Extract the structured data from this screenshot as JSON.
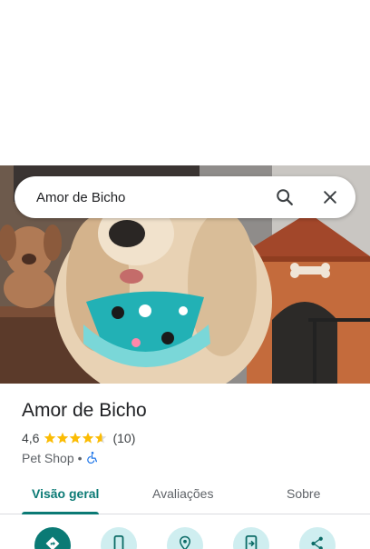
{
  "search": {
    "query": "Amor de Bicho"
  },
  "place": {
    "name": "Amor de Bicho",
    "rating": "4,6",
    "rating_value": 4.6,
    "reviews": "(10)",
    "category": "Pet Shop",
    "separator": "•"
  },
  "tabs": [
    {
      "label": "Visão geral",
      "active": true
    },
    {
      "label": "Avaliações",
      "active": false
    },
    {
      "label": "Sobre",
      "active": false
    }
  ],
  "actions": [
    {
      "icon": "directions-icon"
    },
    {
      "icon": "phone-icon"
    },
    {
      "icon": "save-location-icon"
    },
    {
      "icon": "send-to-phone-icon"
    },
    {
      "icon": "share-icon"
    }
  ],
  "colors": {
    "accent": "#0b7a75",
    "star": "#fbbc04",
    "chip": "#cfeef0"
  }
}
